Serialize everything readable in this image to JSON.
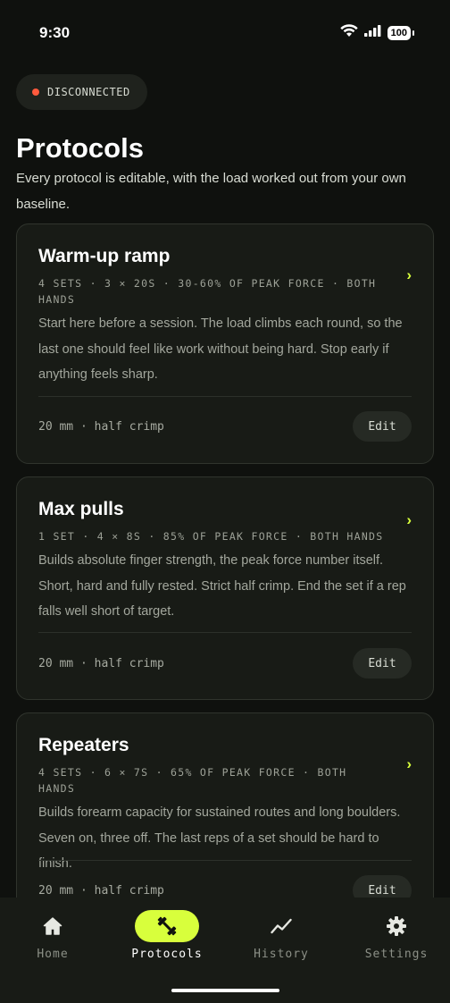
{
  "status_bar": {
    "time": "9:30",
    "battery": "100"
  },
  "connection": {
    "label": "DISCONNECTED",
    "color": "#ff5a3d"
  },
  "header": {
    "title": "Protocols",
    "subtitle": "Every protocol is editable, with the load worked out from your own baseline."
  },
  "protocols": [
    {
      "title": "Warm-up ramp",
      "meta": "4 SETS · 3 × 20S · 30-60% OF PEAK FORCE · BOTH HANDS",
      "description": "Start here before a session. The load climbs each round, so the last one should feel like work without being hard. Stop early if anything feels sharp.",
      "grip": "20 mm · half crimp",
      "edit_label": "Edit"
    },
    {
      "title": "Max pulls",
      "meta": "1 SET · 4 × 8S · 85% OF PEAK FORCE · BOTH HANDS",
      "description": "Builds absolute finger strength, the peak force number itself. Short, hard and fully rested. Strict half crimp. End the set if a rep falls well short of target.",
      "grip": "20 mm · half crimp",
      "edit_label": "Edit"
    },
    {
      "title": "Repeaters",
      "meta": "4 SETS · 6 × 7S · 65% OF PEAK FORCE · BOTH HANDS",
      "description": "Builds forearm capacity for sustained routes and long boulders. Seven on, three off. The last reps of a set should be hard to finish.",
      "grip": "20 mm · half crimp",
      "edit_label": "Edit"
    }
  ],
  "chevron": "›",
  "tabs": [
    {
      "label": "Home",
      "icon": "home-icon"
    },
    {
      "label": "Protocols",
      "icon": "dumbbell-icon",
      "active": true
    },
    {
      "label": "History",
      "icon": "trend-icon"
    },
    {
      "label": "Settings",
      "icon": "gear-icon"
    }
  ],
  "colors": {
    "accent": "#d8ff3c",
    "background": "#0f110e",
    "card": "#181b16"
  }
}
